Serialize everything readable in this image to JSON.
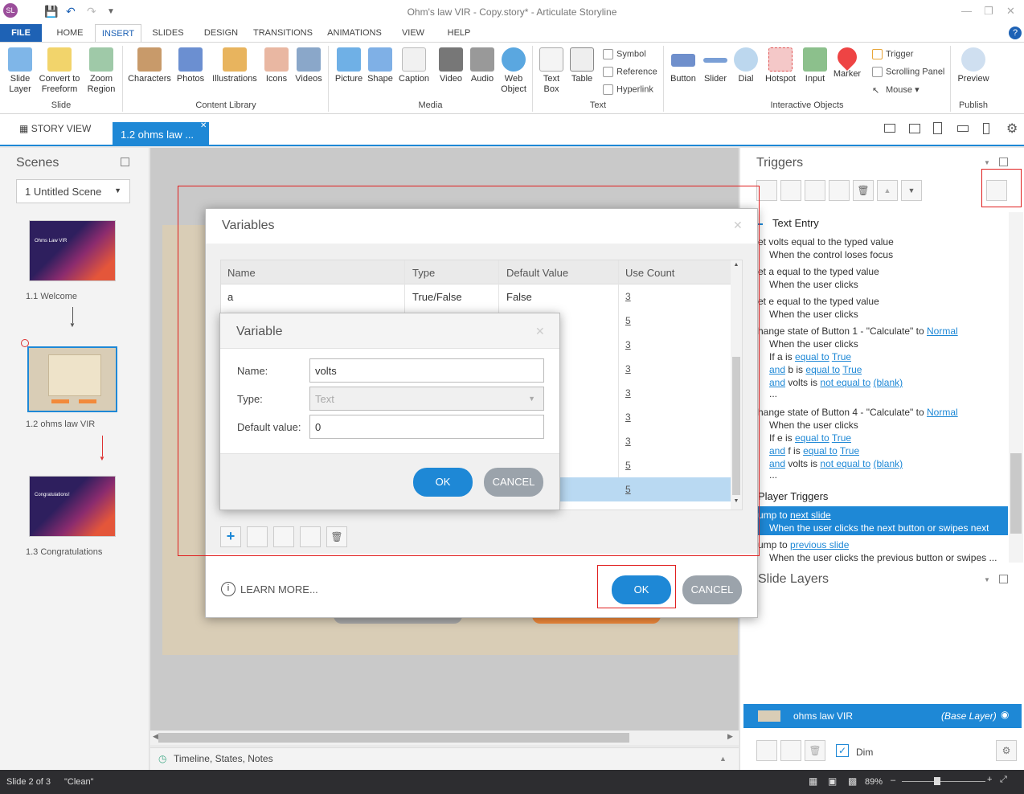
{
  "titlebar": {
    "app_initials": "SL",
    "title": "Ohm's law VIR - Copy.story* - Articulate Storyline"
  },
  "ribbon_tabs": [
    "FILE",
    "HOME",
    "INSERT",
    "SLIDES",
    "DESIGN",
    "TRANSITIONS",
    "ANIMATIONS",
    "VIEW",
    "HELP"
  ],
  "ribbon": {
    "slide_group": {
      "label": "Slide",
      "buttons": [
        "Slide Layer",
        "Convert to Freeform",
        "Zoom Region"
      ]
    },
    "content_group": {
      "label": "Content Library",
      "buttons": [
        "Characters",
        "Photos",
        "Illustrations",
        "Icons",
        "Videos"
      ]
    },
    "media_group": {
      "label": "Media",
      "buttons": [
        "Picture",
        "Shape",
        "Caption",
        "Video",
        "Audio",
        "Web Object"
      ]
    },
    "text_group": {
      "label": "Text",
      "buttons": [
        "Text Box",
        "Table"
      ],
      "small": [
        "Symbol",
        "Reference",
        "Hyperlink"
      ]
    },
    "interactive_group": {
      "label": "Interactive Objects",
      "buttons": [
        "Button",
        "Slider",
        "Dial",
        "Hotspot",
        "Input",
        "Marker"
      ],
      "small": [
        "Trigger",
        "Scrolling Panel",
        "Mouse"
      ]
    },
    "publish_group": {
      "label": "Publish",
      "buttons": [
        "Preview"
      ]
    }
  },
  "doctabs": {
    "story_view": "STORY VIEW",
    "active": "1.2 ohms law ..."
  },
  "scenes": {
    "title": "Scenes",
    "scene_select": "1 Untitled Scene",
    "slides": [
      {
        "label": "1.1 Welcome"
      },
      {
        "label": "1.2 ohms law VIR"
      },
      {
        "label": "1.3 Congratulations"
      }
    ],
    "thumb_texts": {
      "welcome": "Ohms Law VIR",
      "congrats": "Congratulations!"
    }
  },
  "timeline_label": "Timeline, States, Notes",
  "triggers_panel": {
    "title": "Triggers",
    "section": "Text Entry",
    "items": [
      {
        "a": "et volts equal to the typed value",
        "b": "When the control loses focus"
      },
      {
        "a": "et a equal to the typed value",
        "b": "When the user clicks"
      },
      {
        "a": "et e equal to the typed value",
        "b": "When the user clicks"
      }
    ],
    "change1": {
      "a": "hange state of Button 1 - \"Calculate\" to",
      "state": "Normal",
      "b": "When the user clicks",
      "c1": "If a is",
      "c1l": "equal to",
      "c1v": "True",
      "c2a": "and",
      "c2": "b is",
      "c2l": "equal to",
      "c2v": "True",
      "c3a": "and",
      "c3": "volts is",
      "c3l": "not equal to",
      "c3v": "(blank)",
      "more": "..."
    },
    "change4": {
      "a": "hange state of Button 4 - \"Calculate\" to",
      "state": "Normal",
      "b": "When the user clicks",
      "c1": "If e is",
      "c1l": "equal to",
      "c1v": "True",
      "c2a": "and",
      "c2": "f is",
      "c2l": "equal to",
      "c2v": "True",
      "c3a": "and",
      "c3": "volts is",
      "c3l": "not equal to",
      "c3v": "(blank)",
      "more": "..."
    },
    "player_title": "Player Triggers",
    "player": [
      {
        "a": "ump to",
        "link": "next slide",
        "b": "When the user clicks the next button or swipes next"
      },
      {
        "a": "ump to",
        "link": "previous slide",
        "b": "When the user clicks the previous button or swipes ..."
      }
    ]
  },
  "slide_layers": {
    "title": "Slide Layers",
    "base_name": "ohms law VIR",
    "base_tag": "(Base Layer)",
    "dim_label": "Dim"
  },
  "variables_dialog": {
    "title": "Variables",
    "columns": [
      "Name",
      "Type",
      "Default Value",
      "Use Count"
    ],
    "rows": [
      {
        "name": "a",
        "type": "True/False",
        "default": "False",
        "count": "3"
      },
      {
        "count": "5"
      },
      {
        "count": "3"
      },
      {
        "count": "3"
      },
      {
        "count": "3"
      },
      {
        "count": "3"
      },
      {
        "count": "3"
      },
      {
        "count": "5"
      },
      {
        "count": "5"
      }
    ],
    "learn_more": "LEARN MORE...",
    "ok": "OK",
    "cancel": "CANCEL"
  },
  "variable_dialog": {
    "title": "Variable",
    "name_label": "Name:",
    "name_value": "volts",
    "type_label": "Type:",
    "type_value": "Text",
    "default_label": "Default value:",
    "default_value": "0",
    "ok": "OK",
    "cancel": "CANCEL"
  },
  "status": {
    "slide": "Slide 2 of 3",
    "theme": "\"Clean\"",
    "zoom": "89%"
  },
  "colors": {
    "accent": "#1e88d6",
    "highlight": "#1e88d6",
    "annotation": "#e01e1e"
  }
}
